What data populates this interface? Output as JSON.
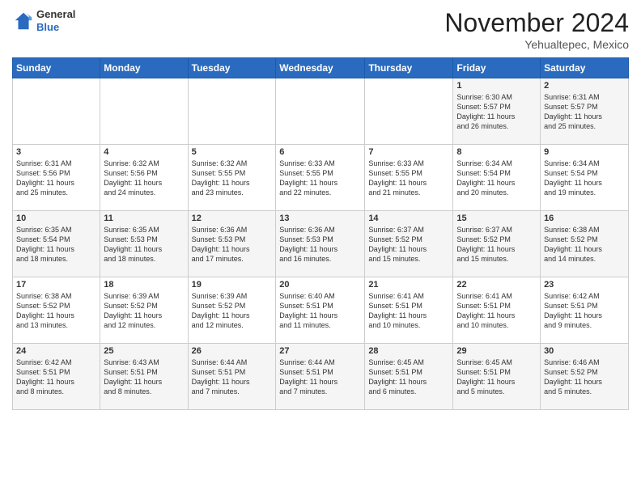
{
  "logo": {
    "line1": "General",
    "line2": "Blue"
  },
  "header": {
    "month": "November 2024",
    "location": "Yehualtepec, Mexico"
  },
  "weekdays": [
    "Sunday",
    "Monday",
    "Tuesday",
    "Wednesday",
    "Thursday",
    "Friday",
    "Saturday"
  ],
  "weeks": [
    [
      {
        "day": "",
        "info": ""
      },
      {
        "day": "",
        "info": ""
      },
      {
        "day": "",
        "info": ""
      },
      {
        "day": "",
        "info": ""
      },
      {
        "day": "",
        "info": ""
      },
      {
        "day": "1",
        "info": "Sunrise: 6:30 AM\nSunset: 5:57 PM\nDaylight: 11 hours\nand 26 minutes."
      },
      {
        "day": "2",
        "info": "Sunrise: 6:31 AM\nSunset: 5:57 PM\nDaylight: 11 hours\nand 25 minutes."
      }
    ],
    [
      {
        "day": "3",
        "info": "Sunrise: 6:31 AM\nSunset: 5:56 PM\nDaylight: 11 hours\nand 25 minutes."
      },
      {
        "day": "4",
        "info": "Sunrise: 6:32 AM\nSunset: 5:56 PM\nDaylight: 11 hours\nand 24 minutes."
      },
      {
        "day": "5",
        "info": "Sunrise: 6:32 AM\nSunset: 5:55 PM\nDaylight: 11 hours\nand 23 minutes."
      },
      {
        "day": "6",
        "info": "Sunrise: 6:33 AM\nSunset: 5:55 PM\nDaylight: 11 hours\nand 22 minutes."
      },
      {
        "day": "7",
        "info": "Sunrise: 6:33 AM\nSunset: 5:55 PM\nDaylight: 11 hours\nand 21 minutes."
      },
      {
        "day": "8",
        "info": "Sunrise: 6:34 AM\nSunset: 5:54 PM\nDaylight: 11 hours\nand 20 minutes."
      },
      {
        "day": "9",
        "info": "Sunrise: 6:34 AM\nSunset: 5:54 PM\nDaylight: 11 hours\nand 19 minutes."
      }
    ],
    [
      {
        "day": "10",
        "info": "Sunrise: 6:35 AM\nSunset: 5:54 PM\nDaylight: 11 hours\nand 18 minutes."
      },
      {
        "day": "11",
        "info": "Sunrise: 6:35 AM\nSunset: 5:53 PM\nDaylight: 11 hours\nand 18 minutes."
      },
      {
        "day": "12",
        "info": "Sunrise: 6:36 AM\nSunset: 5:53 PM\nDaylight: 11 hours\nand 17 minutes."
      },
      {
        "day": "13",
        "info": "Sunrise: 6:36 AM\nSunset: 5:53 PM\nDaylight: 11 hours\nand 16 minutes."
      },
      {
        "day": "14",
        "info": "Sunrise: 6:37 AM\nSunset: 5:52 PM\nDaylight: 11 hours\nand 15 minutes."
      },
      {
        "day": "15",
        "info": "Sunrise: 6:37 AM\nSunset: 5:52 PM\nDaylight: 11 hours\nand 15 minutes."
      },
      {
        "day": "16",
        "info": "Sunrise: 6:38 AM\nSunset: 5:52 PM\nDaylight: 11 hours\nand 14 minutes."
      }
    ],
    [
      {
        "day": "17",
        "info": "Sunrise: 6:38 AM\nSunset: 5:52 PM\nDaylight: 11 hours\nand 13 minutes."
      },
      {
        "day": "18",
        "info": "Sunrise: 6:39 AM\nSunset: 5:52 PM\nDaylight: 11 hours\nand 12 minutes."
      },
      {
        "day": "19",
        "info": "Sunrise: 6:39 AM\nSunset: 5:52 PM\nDaylight: 11 hours\nand 12 minutes."
      },
      {
        "day": "20",
        "info": "Sunrise: 6:40 AM\nSunset: 5:51 PM\nDaylight: 11 hours\nand 11 minutes."
      },
      {
        "day": "21",
        "info": "Sunrise: 6:41 AM\nSunset: 5:51 PM\nDaylight: 11 hours\nand 10 minutes."
      },
      {
        "day": "22",
        "info": "Sunrise: 6:41 AM\nSunset: 5:51 PM\nDaylight: 11 hours\nand 10 minutes."
      },
      {
        "day": "23",
        "info": "Sunrise: 6:42 AM\nSunset: 5:51 PM\nDaylight: 11 hours\nand 9 minutes."
      }
    ],
    [
      {
        "day": "24",
        "info": "Sunrise: 6:42 AM\nSunset: 5:51 PM\nDaylight: 11 hours\nand 8 minutes."
      },
      {
        "day": "25",
        "info": "Sunrise: 6:43 AM\nSunset: 5:51 PM\nDaylight: 11 hours\nand 8 minutes."
      },
      {
        "day": "26",
        "info": "Sunrise: 6:44 AM\nSunset: 5:51 PM\nDaylight: 11 hours\nand 7 minutes."
      },
      {
        "day": "27",
        "info": "Sunrise: 6:44 AM\nSunset: 5:51 PM\nDaylight: 11 hours\nand 7 minutes."
      },
      {
        "day": "28",
        "info": "Sunrise: 6:45 AM\nSunset: 5:51 PM\nDaylight: 11 hours\nand 6 minutes."
      },
      {
        "day": "29",
        "info": "Sunrise: 6:45 AM\nSunset: 5:51 PM\nDaylight: 11 hours\nand 5 minutes."
      },
      {
        "day": "30",
        "info": "Sunrise: 6:46 AM\nSunset: 5:52 PM\nDaylight: 11 hours\nand 5 minutes."
      }
    ]
  ]
}
